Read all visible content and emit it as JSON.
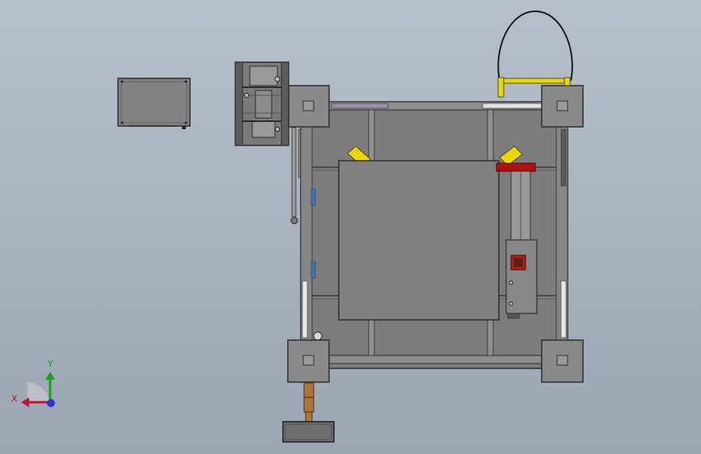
{
  "viewport": {
    "background_top": "#b7c0ca",
    "background_bottom": "#9ba6b3"
  },
  "triad": {
    "x_label": "X",
    "y_label": "Y",
    "x_color": "#c8102e",
    "y_color": "#19a319",
    "z_color": "#2a36d6"
  },
  "colors": {
    "steel": "#6f6f6f",
    "panel": "#808080",
    "dark": "#3a3a3a",
    "yellow": "#e8d800",
    "red": "#b01010",
    "copper": "#a8763a",
    "blue": "#3b78b8"
  }
}
